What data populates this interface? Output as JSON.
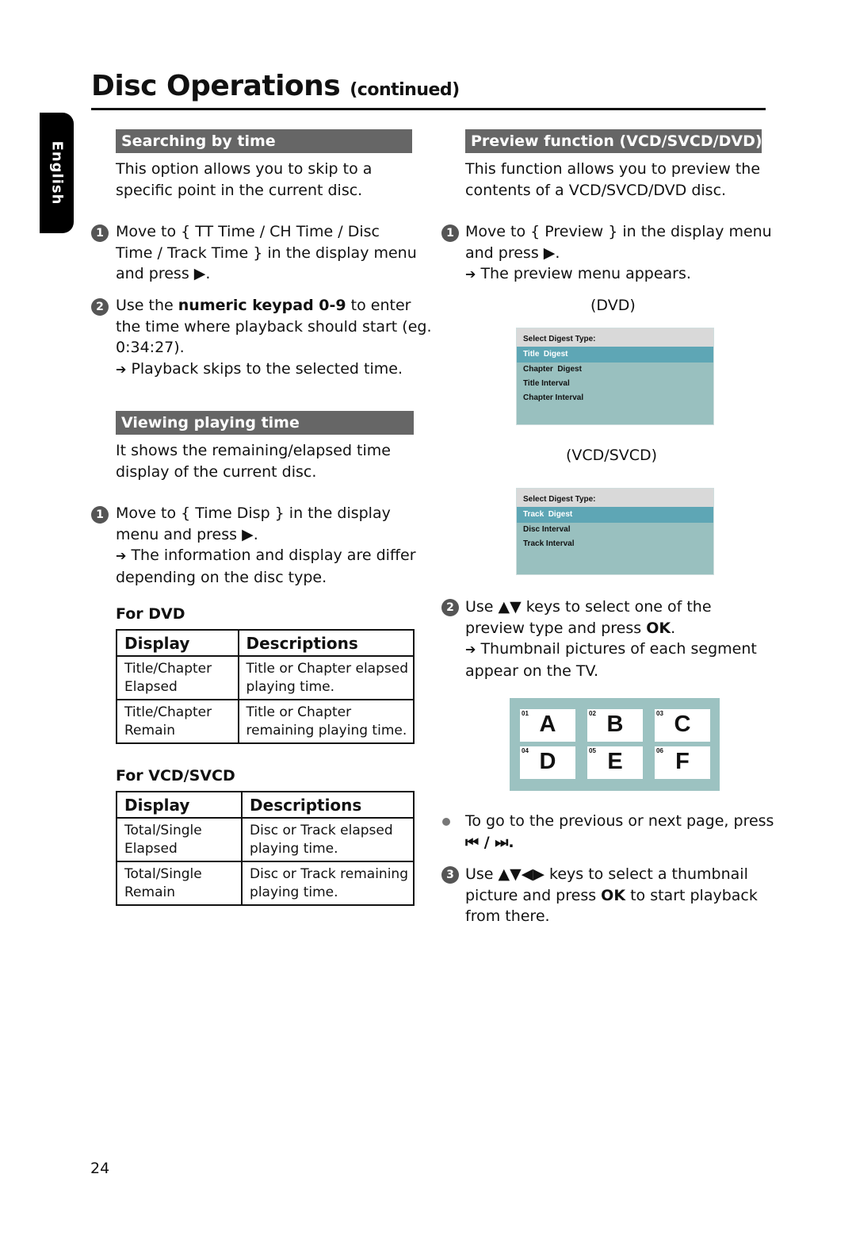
{
  "page": {
    "title": "Disc Operations",
    "title_suffix": "(continued)",
    "language_tab": "English",
    "page_number": "24"
  },
  "left": {
    "searching": {
      "heading": "Searching by time",
      "intro": [
        "This option allows you to skip to a",
        "specific point in the current disc."
      ],
      "step1": {
        "num": "1",
        "lines": [
          "Move to { TT Time / CH Time / Disc",
          "Time / Track Time } in the display menu",
          "and press ▶."
        ]
      },
      "step2": {
        "num": "2",
        "pre": "Use the ",
        "bold": "numeric keypad 0-9",
        "post": " to enter",
        "lines": [
          "the time where playback should start (eg.",
          "0:34:27)."
        ],
        "result_arrow": "➔",
        "result": " Playback skips to the selected time."
      }
    },
    "viewing": {
      "heading": "Viewing playing time",
      "intro": [
        "It shows the remaining/elapsed time",
        "display of the current disc."
      ],
      "step1": {
        "num": "1",
        "lines": [
          "Move to { Time Disp } in the display",
          "menu and press ▶."
        ],
        "result_arrow": "➔",
        "result_lines": [
          " The information and display are differ",
          "depending on the disc type."
        ]
      }
    },
    "dvd_table": {
      "label": "For DVD",
      "headers": [
        "Display",
        "Descriptions"
      ],
      "rows": [
        [
          [
            "Title/Chapter",
            "Elapsed"
          ],
          [
            "Title or Chapter elapsed",
            "playing time."
          ]
        ],
        [
          [
            "Title/Chapter",
            "Remain"
          ],
          [
            "Title or Chapter",
            "remaining playing time."
          ]
        ]
      ]
    },
    "vcd_table": {
      "label": "For VCD/SVCD",
      "headers": [
        "Display",
        "Descriptions"
      ],
      "rows": [
        [
          [
            "Total/Single",
            "Elapsed"
          ],
          [
            "Disc or Track elapsed",
            "playing time."
          ]
        ],
        [
          [
            "Total/Single",
            "Remain"
          ],
          [
            "Disc or Track remaining",
            "playing time."
          ]
        ]
      ]
    }
  },
  "right": {
    "preview": {
      "heading": "Preview function (VCD/SVCD/DVD)",
      "intro": [
        "This function allows you to preview the",
        "contents of a VCD/SVCD/DVD disc."
      ],
      "step1": {
        "num": "1",
        "lines": [
          "Move to { Preview } in the display menu",
          "and press ▶."
        ],
        "result_arrow": "➔",
        "result": " The preview menu appears."
      },
      "dvd_caption": "(DVD)",
      "dvd_menu": {
        "header": "Select Digest Type:",
        "items": [
          "Title  Digest",
          "Chapter  Digest",
          "Title Interval",
          "Chapter Interval"
        ],
        "selected_index": 0
      },
      "vcd_caption": "(VCD/SVCD)",
      "vcd_menu": {
        "header": "Select Digest Type:",
        "items": [
          "Track  Digest",
          "Disc Interval",
          "Track Interval"
        ],
        "selected_index": 0
      },
      "step2": {
        "num": "2",
        "pre": "Use ▲▼ keys to select one of the",
        "line2_pre": "preview type and press ",
        "line2_bold": "OK",
        "line2_post": ".",
        "result_arrow": "➔",
        "result_lines": [
          " Thumbnail pictures of each segment",
          "appear on the TV."
        ]
      },
      "thumbnails": [
        {
          "num": "01",
          "label": "A"
        },
        {
          "num": "02",
          "label": "B"
        },
        {
          "num": "03",
          "label": "C"
        },
        {
          "num": "04",
          "label": "D"
        },
        {
          "num": "05",
          "label": "E"
        },
        {
          "num": "06",
          "label": "F"
        }
      ],
      "bullet": {
        "line1": "To go to the previous or next page, press",
        "line2": "⏮ / ⏭."
      },
      "step3": {
        "num": "3",
        "pre": "Use ▲▼◀▶ keys to select a thumbnail",
        "line2_pre": "picture and press ",
        "line2_bold": "OK",
        "line2_post": " to start playback",
        "line3": "from there."
      }
    }
  },
  "colors": {
    "section_heading_bg": "#666666",
    "menu_bg": "#99c0bf",
    "menu_header_bg": "#d9d9d9",
    "menu_selected_bg": "#5ea6b5",
    "thumb_grid_bg": "#9cc2c1"
  }
}
